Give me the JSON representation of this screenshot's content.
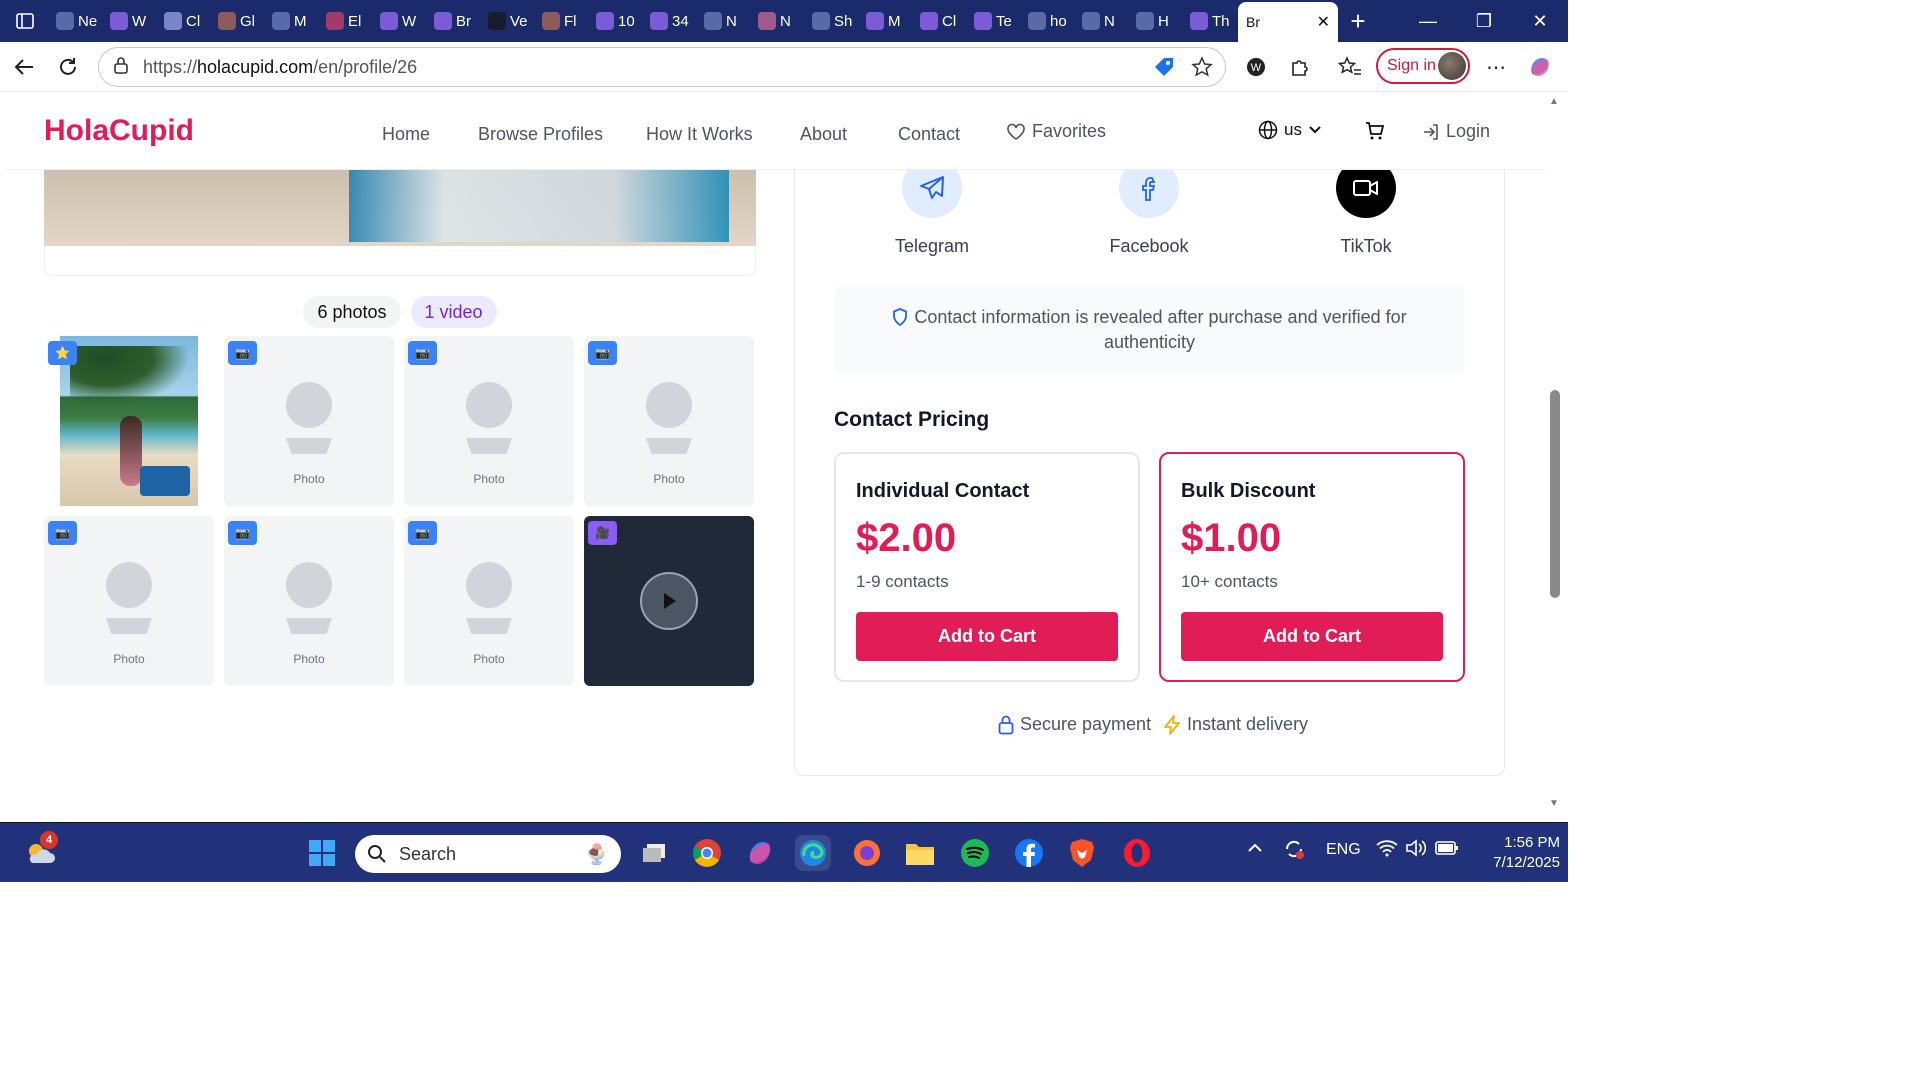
{
  "browser": {
    "tabs": [
      {
        "label": "Ne",
        "icon_color": "#5a6aa8"
      },
      {
        "label": "W",
        "icon_color": "#7c5cd6"
      },
      {
        "label": "Cl",
        "icon_color": "#7a86c8"
      },
      {
        "label": "Gl",
        "icon_color": "#8b5a5a"
      },
      {
        "label": "M",
        "icon_color": "#5a6aa8"
      },
      {
        "label": "El",
        "icon_color": "#a23a6a"
      },
      {
        "label": "W",
        "icon_color": "#7c5cd6"
      },
      {
        "label": "Br",
        "icon_color": "#7c5cd6"
      },
      {
        "label": "Ve",
        "icon_color": "#1a1a2e"
      },
      {
        "label": "Fl",
        "icon_color": "#8b5a5a"
      },
      {
        "label": "10",
        "icon_color": "#7c5cd6"
      },
      {
        "label": "34",
        "icon_color": "#7c5cd6"
      },
      {
        "label": "N",
        "icon_color": "#5a6aa8"
      },
      {
        "label": "N",
        "icon_color": "#a05a8a"
      },
      {
        "label": "Sh",
        "icon_color": "#5a6aa8"
      },
      {
        "label": "M",
        "icon_color": "#7c5cd6"
      },
      {
        "label": "Cl",
        "icon_color": "#7c5cd6"
      },
      {
        "label": "Te",
        "icon_color": "#7c5cd6"
      },
      {
        "label": "ho",
        "icon_color": "#5a6aa8"
      },
      {
        "label": "N",
        "icon_color": "#5a6aa8"
      },
      {
        "label": "H",
        "icon_color": "#5a6aa8"
      },
      {
        "label": "Th",
        "icon_color": "#7c5cd6"
      }
    ],
    "active_tab": "Br",
    "url_prefix": "https://",
    "url_domain": "holacupid.com",
    "url_path": "/en/profile/26",
    "sign_in_label": "Sign in"
  },
  "site": {
    "logo": "HolaCupid",
    "nav": {
      "home": "Home",
      "browse": "Browse Profiles",
      "how": "How It Works",
      "about": "About",
      "contact": "Contact",
      "favorites": "Favorites"
    },
    "lang": "us",
    "login": "Login"
  },
  "gallery": {
    "photos_pill": "6 photos",
    "video_pill": "1 video",
    "placeholder_label": "Photo"
  },
  "contact": {
    "socials": {
      "telegram": "Telegram",
      "facebook": "Facebook",
      "tiktok": "TikTok"
    },
    "notice": "Contact information is revealed after purchase and verified for authenticity",
    "pricing_title": "Contact Pricing",
    "individual": {
      "name": "Individual Contact",
      "price": "$2.00",
      "range": "1-9 contacts",
      "button": "Add to Cart"
    },
    "bulk": {
      "name": "Bulk Discount",
      "price": "$1.00",
      "range": "10+ contacts",
      "button": "Add to Cart"
    },
    "secure": "Secure payment",
    "instant": "Instant delivery"
  },
  "taskbar": {
    "weather_badge": "4",
    "search_placeholder": "Search",
    "lang": "ENG",
    "time": "1:56 PM",
    "date": "7/12/2025"
  },
  "colors": {
    "brand": "#e11d58",
    "taskbar": "#22327a",
    "tabbar": "#1b2a6b"
  }
}
